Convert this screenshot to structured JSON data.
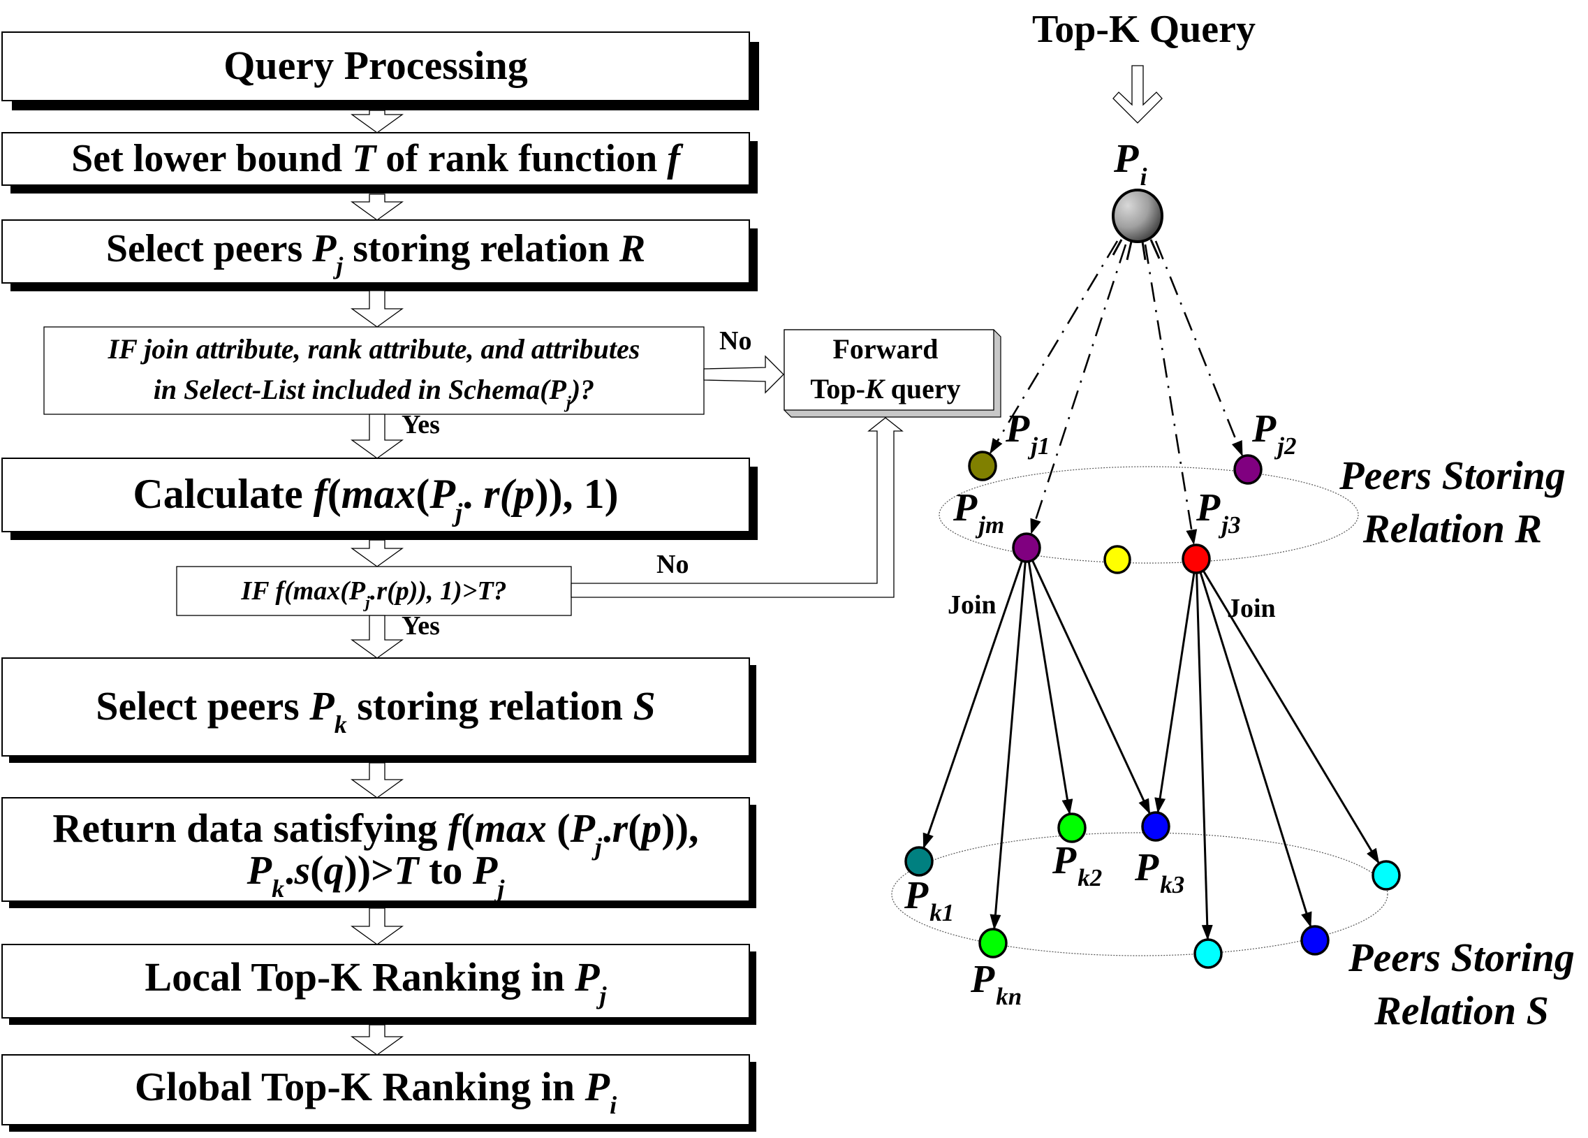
{
  "flowchart": {
    "steps": [
      {
        "id": "query-processing",
        "kind": "process",
        "parts": [
          {
            "t": "Query Processing"
          }
        ]
      },
      {
        "id": "set-lower-bound",
        "kind": "process",
        "parts": [
          {
            "t": "Set lower bound "
          },
          {
            "t": "T",
            "i": true
          },
          {
            "t": " of rank function "
          },
          {
            "t": "f",
            "i": true
          }
        ]
      },
      {
        "id": "select-peers-r",
        "kind": "process",
        "parts": [
          {
            "t": "Select peers "
          },
          {
            "t": "P",
            "i": true
          },
          {
            "t": "j",
            "i": true,
            "sub": true
          },
          {
            "t": " storing relation "
          },
          {
            "t": "R",
            "i": true
          }
        ]
      },
      {
        "id": "decision-schema",
        "kind": "decision",
        "lines": [
          [
            {
              "t": "IF join attribute, rank attribute, and attributes",
              "i": true
            }
          ],
          [
            {
              "t": "in Select-List included in Schema(",
              "i": true
            },
            {
              "t": "P",
              "i": true
            },
            {
              "t": "j",
              "i": true,
              "sub": true
            },
            {
              "t": ")?",
              "i": true
            }
          ]
        ]
      },
      {
        "id": "calculate",
        "kind": "process",
        "parts": [
          {
            "t": "Calculate  "
          },
          {
            "t": "f",
            "i": true
          },
          {
            "t": "("
          },
          {
            "t": "max",
            "i": true
          },
          {
            "t": "("
          },
          {
            "t": "P",
            "i": true
          },
          {
            "t": "j",
            "i": true,
            "sub": true
          },
          {
            "t": ". "
          },
          {
            "t": "r(",
            "i": true
          },
          {
            "t": "p",
            "i": true
          },
          {
            "t": ")), 1)"
          }
        ]
      },
      {
        "id": "decision-threshold",
        "kind": "decision",
        "parts": [
          {
            "t": "IF f(max(P",
            "i": true
          },
          {
            "t": "j",
            "i": true,
            "sub": true
          },
          {
            "t": ".r(p)), 1)>T?",
            "i": true
          }
        ]
      },
      {
        "id": "select-peers-s",
        "kind": "process",
        "parts": [
          {
            "t": "Select peers "
          },
          {
            "t": "P",
            "i": true
          },
          {
            "t": "k",
            "i": true,
            "sub": true
          },
          {
            "t": " storing relation "
          },
          {
            "t": "S",
            "i": true
          }
        ]
      },
      {
        "id": "return-data",
        "kind": "process",
        "lines": [
          [
            {
              "t": "Return data satisfying "
            },
            {
              "t": "f",
              "i": true
            },
            {
              "t": "("
            },
            {
              "t": "max",
              "i": true
            },
            {
              "t": " ("
            },
            {
              "t": "P",
              "i": true
            },
            {
              "t": "j",
              "i": true,
              "sub": true
            },
            {
              "t": "."
            },
            {
              "t": "r",
              "i": true
            },
            {
              "t": "("
            },
            {
              "t": "p",
              "i": true
            },
            {
              "t": ")),"
            }
          ],
          [
            {
              "t": "P",
              "i": true
            },
            {
              "t": "k",
              "i": true,
              "sub": true
            },
            {
              "t": "."
            },
            {
              "t": "s",
              "i": true
            },
            {
              "t": "("
            },
            {
              "t": "q",
              "i": true
            },
            {
              "t": "))>"
            },
            {
              "t": "T",
              "i": true
            },
            {
              "t": " to "
            },
            {
              "t": "P",
              "i": true
            },
            {
              "t": "j",
              "i": true,
              "sub": true
            }
          ]
        ]
      },
      {
        "id": "local-ranking",
        "kind": "process",
        "parts": [
          {
            "t": "Local Top-K Ranking in "
          },
          {
            "t": "P",
            "i": true
          },
          {
            "t": "j",
            "i": true,
            "sub": true
          }
        ]
      },
      {
        "id": "global-ranking",
        "kind": "process",
        "parts": [
          {
            "t": "Global Top-K Ranking in "
          },
          {
            "t": "P",
            "i": true
          },
          {
            "t": "i",
            "i": true,
            "sub": true
          }
        ]
      }
    ],
    "forward_box": {
      "lines": [
        [
          {
            "t": "Forward"
          }
        ],
        [
          {
            "t": "Top-"
          },
          {
            "t": "K",
            "i": true
          },
          {
            "t": " query"
          }
        ]
      ]
    },
    "branch_labels": {
      "yes": "Yes",
      "no": "No"
    }
  },
  "network": {
    "query_label": "Top-K Query",
    "origin_peer": {
      "base": "P",
      "sub": "i"
    },
    "join_label": "Join",
    "relation_r_label": [
      "Peers Storing",
      "Relation R"
    ],
    "relation_s_label": [
      "Peers Storing",
      "Relation S"
    ],
    "colors": {
      "olive": "#808000",
      "purple": "#800080",
      "yellow": "#ffff00",
      "red": "#ff0000",
      "teal": "#008080",
      "green": "#00ff00",
      "blue": "#0000ff",
      "cyan": "#00ffff",
      "gray_light": "#d8d8d8",
      "gray_dark": "#2a2a2a"
    },
    "peers_r": [
      {
        "id": "pj1",
        "color": "olive",
        "base": "P",
        "sub": "j1"
      },
      {
        "id": "pj2",
        "color": "purple",
        "base": "P",
        "sub": "j2"
      },
      {
        "id": "pjm",
        "color": "purple",
        "base": "P",
        "sub": "jm"
      },
      {
        "id": "pr-unlabeled",
        "color": "yellow",
        "base": "",
        "sub": ""
      },
      {
        "id": "pj3",
        "color": "red",
        "base": "P",
        "sub": "j3"
      }
    ],
    "peers_s": [
      {
        "id": "pk1",
        "color": "teal",
        "base": "P",
        "sub": "k1"
      },
      {
        "id": "pk2",
        "color": "green",
        "base": "P",
        "sub": "k2"
      },
      {
        "id": "pk3",
        "color": "blue",
        "base": "P",
        "sub": "k3"
      },
      {
        "id": "ps-cyan-right",
        "color": "cyan",
        "base": "",
        "sub": ""
      },
      {
        "id": "pkn",
        "color": "green",
        "base": "P",
        "sub": "kn"
      },
      {
        "id": "ps-cyan-bottom",
        "color": "cyan",
        "base": "",
        "sub": ""
      },
      {
        "id": "ps-blue-bottom",
        "color": "blue",
        "base": "",
        "sub": ""
      }
    ],
    "query_edges": [
      {
        "from": "pi",
        "to": "pj1"
      },
      {
        "from": "pi",
        "to": "pjm"
      },
      {
        "from": "pi",
        "to": "pj3"
      },
      {
        "from": "pi",
        "to": "pj2"
      }
    ],
    "join_edges": [
      {
        "from": "pjm",
        "to": "pk1"
      },
      {
        "from": "pjm",
        "to": "pkn"
      },
      {
        "from": "pjm",
        "to": "pk2"
      },
      {
        "from": "pjm",
        "to": "pk3"
      },
      {
        "from": "pj3",
        "to": "pk3"
      },
      {
        "from": "pj3",
        "to": "ps-cyan-bottom"
      },
      {
        "from": "pj3",
        "to": "ps-blue-bottom"
      },
      {
        "from": "pj3",
        "to": "ps-cyan-right"
      }
    ]
  }
}
